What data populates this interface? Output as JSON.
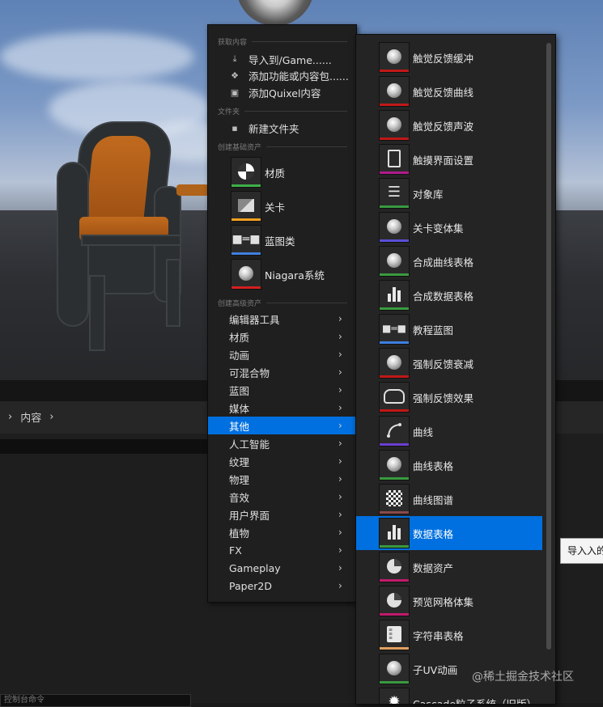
{
  "menu": {
    "sections": {
      "get_content": "获取内容",
      "folder": "文件夹",
      "create_basic": "创建基础资产",
      "create_advanced": "创建高级资产"
    },
    "actions": [
      {
        "label": "导入到/Game......",
        "icon": "import-icon"
      },
      {
        "label": "添加功能或内容包......",
        "icon": "add-feature-pack-icon"
      },
      {
        "label": "添加Quixel内容",
        "icon": "quixel-icon"
      }
    ],
    "new_folder": {
      "label": "新建文件夹",
      "icon": "new-folder-icon"
    },
    "basic_assets": [
      {
        "label": "材质",
        "icon": "material-icon",
        "color": "#3fae49"
      },
      {
        "label": "关卡",
        "icon": "level-icon",
        "color": "#f0a020"
      },
      {
        "label": "蓝图类",
        "icon": "blueprint-class-icon",
        "color": "#3f7fe0"
      },
      {
        "label": "Niagara系统",
        "icon": "niagara-icon",
        "color": "#d32020"
      }
    ],
    "categories": [
      {
        "label": "编辑器工具"
      },
      {
        "label": "材质"
      },
      {
        "label": "动画"
      },
      {
        "label": "可混合物"
      },
      {
        "label": "蓝图"
      },
      {
        "label": "媒体"
      },
      {
        "label": "其他",
        "selected": true
      },
      {
        "label": "人工智能"
      },
      {
        "label": "纹理"
      },
      {
        "label": "物理"
      },
      {
        "label": "音效"
      },
      {
        "label": "用户界面"
      },
      {
        "label": "植物"
      },
      {
        "label": "FX"
      },
      {
        "label": "Gameplay"
      },
      {
        "label": "Paper2D"
      }
    ]
  },
  "submenu": {
    "items": [
      {
        "label": "触觉反馈缓冲",
        "icon": "sphere-icon",
        "color": "#c01818"
      },
      {
        "label": "触觉反馈曲线",
        "icon": "sphere-icon",
        "color": "#c01818"
      },
      {
        "label": "触觉反馈声波",
        "icon": "sphere-icon",
        "color": "#c01818"
      },
      {
        "label": "触摸界面设置",
        "icon": "tablet-icon",
        "color": "#b01b8a"
      },
      {
        "label": "对象库",
        "icon": "stack-icon",
        "color": "#3a9a40"
      },
      {
        "label": "关卡变体集",
        "icon": "sphere-icon",
        "color": "#5a4fd6"
      },
      {
        "label": "合成曲线表格",
        "icon": "sphere-icon",
        "color": "#3a9a40"
      },
      {
        "label": "合成数据表格",
        "icon": "bar-chart-icon",
        "color": "#3a9a40"
      },
      {
        "label": "教程蓝图",
        "icon": "blueprint-icon",
        "color": "#3f7fe0"
      },
      {
        "label": "强制反馈衰减",
        "icon": "sphere-icon",
        "color": "#c01818"
      },
      {
        "label": "强制反馈效果",
        "icon": "controller-icon",
        "color": "#c01818"
      },
      {
        "label": "曲线",
        "icon": "curve-icon",
        "color": "#6a3fcf"
      },
      {
        "label": "曲线表格",
        "icon": "sphere-icon",
        "color": "#3a9a40"
      },
      {
        "label": "曲线图谱",
        "icon": "checker-icon",
        "color": "#8a4a4a"
      },
      {
        "label": "数据表格",
        "icon": "bar-chart-icon",
        "color": "#3a9a40",
        "selected": true
      },
      {
        "label": "数据资产",
        "icon": "pie-icon",
        "color": "#c01b6a"
      },
      {
        "label": "预览网格体集",
        "icon": "pie-icon",
        "color": "#c01b6a"
      },
      {
        "label": "字符串表格",
        "icon": "string-table-icon",
        "color": "#e0a060"
      },
      {
        "label": "子UV动画",
        "icon": "sphere-icon",
        "color": "#3a9a40"
      },
      {
        "label": "Cascade粒子系统（旧版）",
        "icon": "particle-icon",
        "color": "#c01818"
      }
    ]
  },
  "tooltip": {
    "text": "导入入的数"
  },
  "content_browser": {
    "breadcrumb": "内容",
    "console_placeholder": "控制台命令"
  },
  "watermark": "@稀土掘金技术社区"
}
